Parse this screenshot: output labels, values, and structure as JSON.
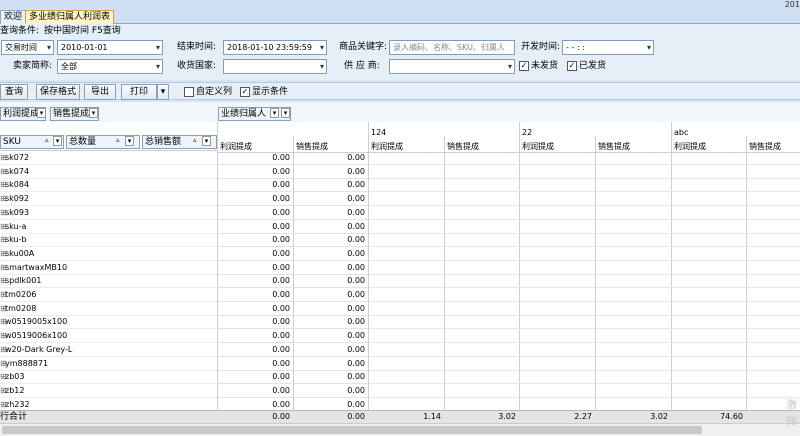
{
  "tabs": {
    "welcome": "欢迎",
    "report": "多业绩归属人利润表"
  },
  "corner_label": "201",
  "filters": {
    "query_condition": "查询条件:",
    "query_hint": "按中国时间  F5查询",
    "trade_time_select": "交易时间",
    "start_date": "2010-01-01",
    "end_time_label": "结束时间:",
    "end_time_value": "2018-01-10 23:59:59",
    "keyword_label": "商品关键字:",
    "keyword_placeholder": "录入编码、名称、SKU、归属人",
    "ship_time_label": "开发时间:",
    "ship_time_value": "- -    : :",
    "seller_label": "卖家简称:",
    "seller_value": "全部",
    "country_label": "收货国家:",
    "country_value": "",
    "supplier_label": "供 应 商:",
    "supplier_value": "",
    "unshipped_label": "未发货",
    "shipped_label": "已发货"
  },
  "toolbar": {
    "query": "查询",
    "save_format": "保存格式",
    "export": "导出",
    "print": "打印",
    "custom_columns": "自定义列",
    "show_conditions": "显示条件"
  },
  "pivot": {
    "data_fields": [
      "利润提成",
      "销售提成"
    ],
    "column_field": "业绩归属人",
    "row_field": "SKU",
    "row_fields_extra": [
      "总数量",
      "总销售额"
    ],
    "column_groups": [
      "124",
      "22",
      "abc"
    ],
    "col_headers": [
      "利润提成",
      "销售提成",
      "利润提成",
      "销售提成",
      "利润提成",
      "销售提成",
      "利润提成",
      "销售提成"
    ],
    "rows": [
      {
        "sku": "sk072",
        "v1": "0.00",
        "v2": "0.00"
      },
      {
        "sku": "sk074",
        "v1": "0.00",
        "v2": "0.00"
      },
      {
        "sku": "sk084",
        "v1": "0.00",
        "v2": "0.00"
      },
      {
        "sku": "sk092",
        "v1": "0.00",
        "v2": "0.00"
      },
      {
        "sku": "sk093",
        "v1": "0.00",
        "v2": "0.00"
      },
      {
        "sku": "sku-a",
        "v1": "0.00",
        "v2": "0.00"
      },
      {
        "sku": "sku-b",
        "v1": "0.00",
        "v2": "0.00"
      },
      {
        "sku": "sku00A",
        "v1": "0.00",
        "v2": "0.00"
      },
      {
        "sku": "smartwaxMB10",
        "v1": "0.00",
        "v2": "0.00"
      },
      {
        "sku": "spdlk001",
        "v1": "0.00",
        "v2": "0.00"
      },
      {
        "sku": "tm0206",
        "v1": "0.00",
        "v2": "0.00"
      },
      {
        "sku": "tm0208",
        "v1": "0.00",
        "v2": "0.00"
      },
      {
        "sku": "w0519005x100",
        "v1": "0.00",
        "v2": "0.00"
      },
      {
        "sku": "w0519006x100",
        "v1": "0.00",
        "v2": "0.00"
      },
      {
        "sku": "w20-Dark Grey-L",
        "v1": "0.00",
        "v2": "0.00"
      },
      {
        "sku": "ym888871",
        "v1": "0.00",
        "v2": "0.00"
      },
      {
        "sku": "zb03",
        "v1": "0.00",
        "v2": "0.00"
      },
      {
        "sku": "zb12",
        "v1": "0.00",
        "v2": "0.00"
      },
      {
        "sku": "zh232",
        "v1": "0.00",
        "v2": "0.00"
      }
    ],
    "total_label": "行合计",
    "totals": [
      "0.00",
      "0.00",
      "1.14",
      "3.02",
      "2.27",
      "3.02",
      "74.60"
    ]
  },
  "watermark": [
    "激",
    "转"
  ]
}
